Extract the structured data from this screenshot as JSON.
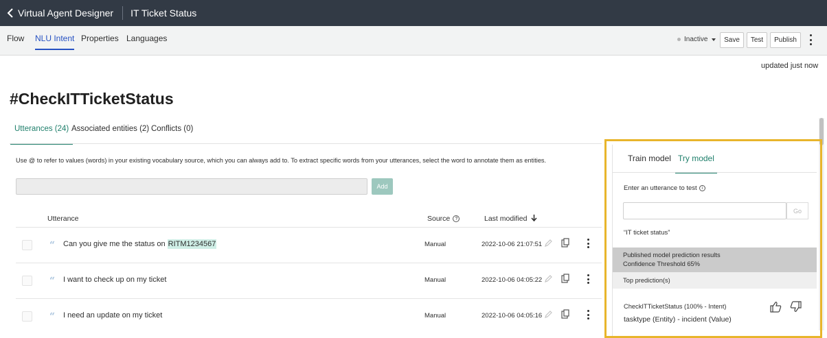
{
  "topbar": {
    "app_title": "Virtual Agent Designer",
    "doc_title": "IT Ticket Status"
  },
  "nav": {
    "tabs": [
      {
        "label": "Flow"
      },
      {
        "label": "NLU Intent"
      },
      {
        "label": "Properties"
      },
      {
        "label": "Languages"
      }
    ],
    "status_label": "Inactive",
    "save_label": "Save",
    "test_label": "Test",
    "publish_label": "Publish"
  },
  "updated_text": "updated  just now",
  "intent_title": "#CheckITTicketStatus",
  "content_tabs": [
    {
      "label": "Utterances (24)"
    },
    {
      "label": "Associated entities (2)"
    },
    {
      "label": "Conflicts (0)"
    }
  ],
  "help_text": "Use @ to refer to values (words) in your existing vocabulary source, which you can always add to. To extract specific words from your utterances, select the word to annotate them as entities.",
  "add_input": {
    "value": "",
    "placeholder": ""
  },
  "add_label": "Add",
  "table": {
    "headers": {
      "utterance": "Utterance",
      "source": "Source",
      "last_modified": "Last modified"
    },
    "sort_icon": "arrow-down-icon",
    "rows": [
      {
        "text": "Can you give me the status on ",
        "highlight": "RITM1234567",
        "source": "Manual",
        "modified": "2022-10-06 21:07:51"
      },
      {
        "text": "I want to check up on my ticket",
        "highlight": "",
        "source": "Manual",
        "modified": "2022-10-06 04:05:22"
      },
      {
        "text": "I need an update on my ticket",
        "highlight": "",
        "source": "Manual",
        "modified": "2022-10-06 04:05:16"
      }
    ]
  },
  "panel": {
    "tabs": [
      {
        "label": "Train model"
      },
      {
        "label": "Try model"
      }
    ],
    "input_label": "Enter an utterance to test",
    "input_value": "",
    "go_label": "Go",
    "tested_utterance": "“IT ticket status”",
    "results_title": "Published model prediction results",
    "confidence": "Confidence Threshold 65%",
    "top_predictions": "Top prediction(s)",
    "prediction_intent": "CheckITTicketStatus (100% - Intent)",
    "prediction_entity": "tasktype (Entity) - incident (Value)"
  },
  "colors": {
    "accent_blue": "#2651c2",
    "accent_green": "#1f7f6b",
    "highlight_frame": "#e8b52b",
    "topbar": "#323a45"
  }
}
